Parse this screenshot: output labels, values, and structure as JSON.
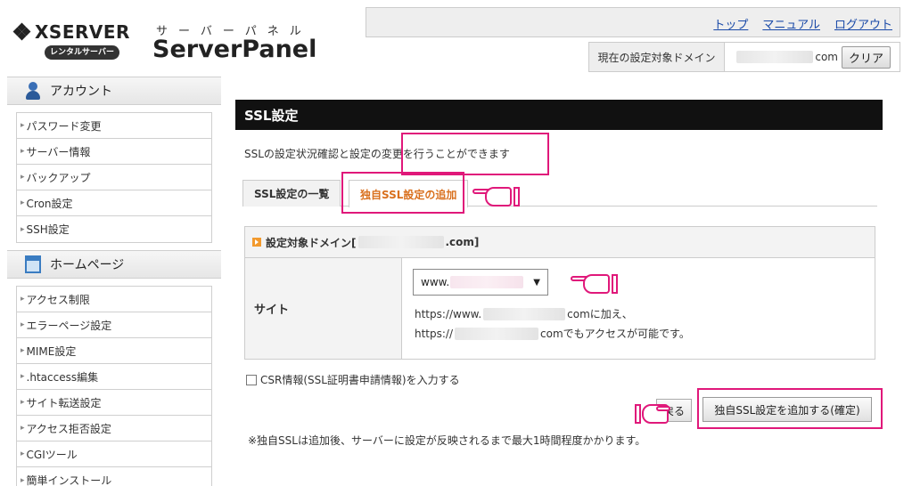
{
  "header": {
    "logo_text": "XSERVER",
    "logo_badge": "レンタルサーバー",
    "panel_sub": "サーバーパネル",
    "panel_title": "ServerPanel",
    "links": [
      "トップ",
      "マニュアル",
      "ログアウト"
    ],
    "domain_label": "現在の設定対象ドメイン",
    "domain_value_suffix": "com",
    "clear_label": "クリア"
  },
  "sidebar": {
    "sections": [
      {
        "title": "アカウント",
        "icon": "user-icon",
        "items": [
          "パスワード変更",
          "サーバー情報",
          "バックアップ",
          "Cron設定",
          "SSH設定"
        ]
      },
      {
        "title": "ホームページ",
        "icon": "homepage-icon",
        "items": [
          "アクセス制限",
          "エラーページ設定",
          "MIME設定",
          ".htaccess編集",
          "サイト転送設定",
          "アクセス拒否設定",
          "CGIツール",
          "簡単インストール"
        ]
      }
    ]
  },
  "main": {
    "title": "SSL設定",
    "description": "SSLの設定状況確認と設定の変更を行うことができます",
    "tabs": [
      "SSL設定の一覧",
      "独自SSL設定の追加"
    ],
    "panel": {
      "head_prefix": "設定対象ドメイン[",
      "head_suffix": ".com]",
      "row_label": "サイト",
      "select_prefix": "www.",
      "select_arrow": "▼",
      "url1_prefix": "https://www.",
      "url1_suffix": "comに加え、",
      "url2_prefix": "https://",
      "url2_suffix": "comでもアクセスが可能です。"
    },
    "csr_label": "CSR情報(SSL証明書申請情報)を入力する",
    "back_label": "戻る",
    "add_label": "独自SSL設定を追加する(確定)",
    "note": "※独自SSLは追加後、サーバーに設定が反映されるまで最大1時間程度かかります。"
  },
  "colors": {
    "highlight": "#e0187a",
    "active_tab": "#d9701e",
    "title_bar": "#111111",
    "link": "#1a4aa8"
  },
  "icons": [
    "pointing-hand-icon",
    "user-icon",
    "homepage-icon",
    "arrow-icon"
  ]
}
